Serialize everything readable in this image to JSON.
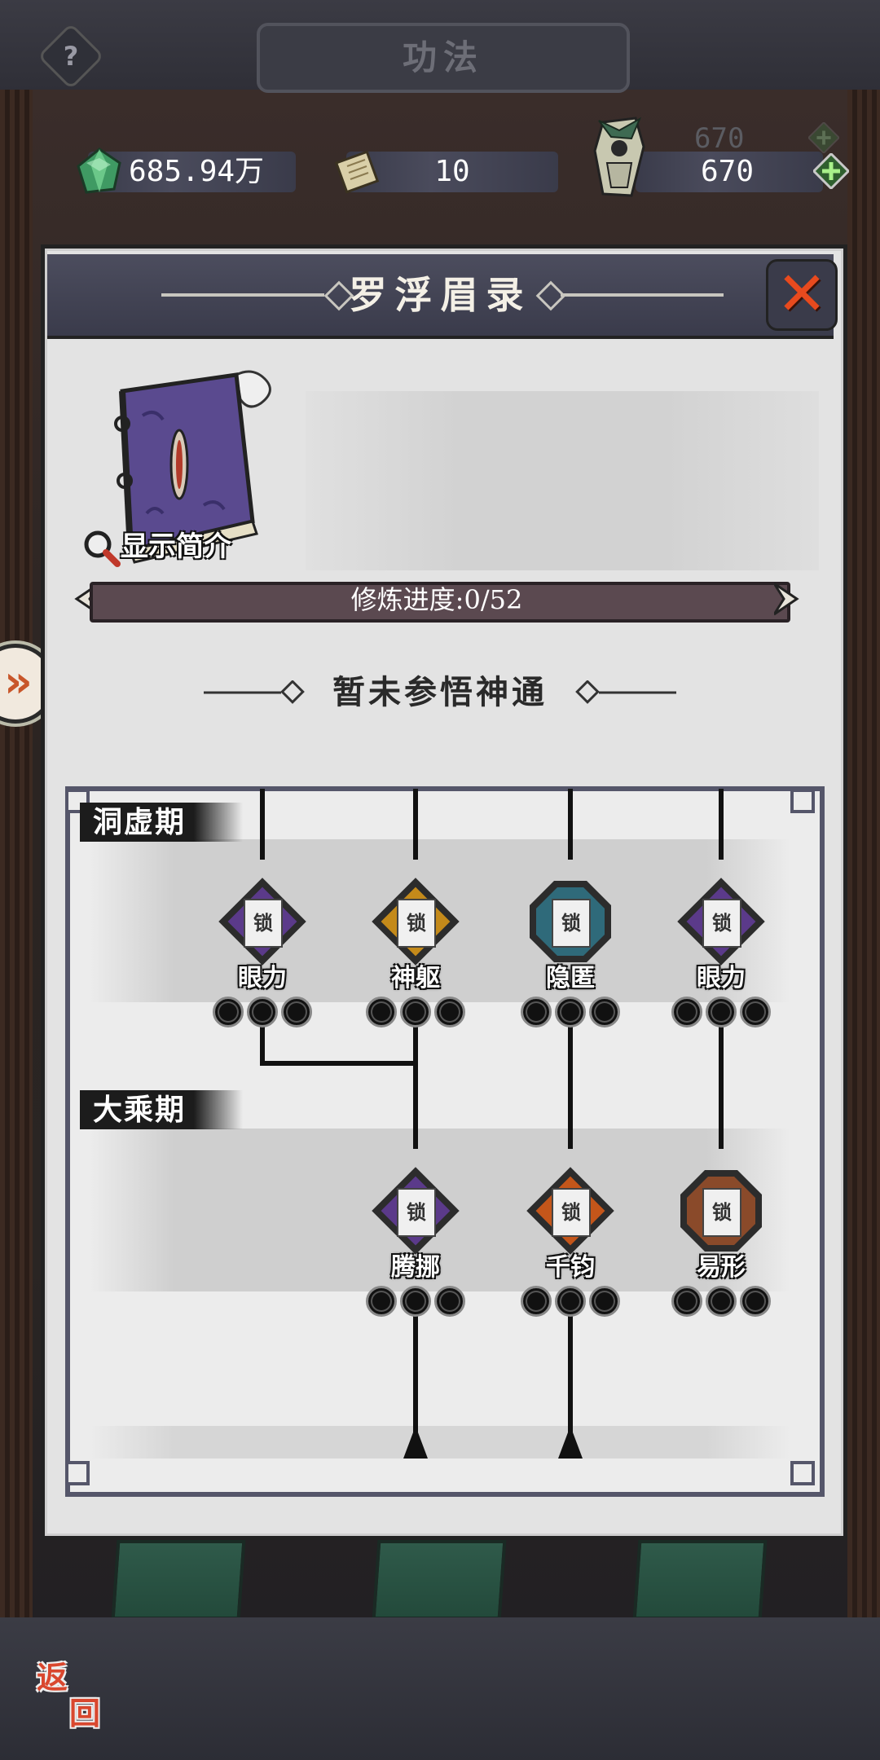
{
  "header": {
    "title": "功法",
    "help_glyph": "?"
  },
  "resources": {
    "spirit_stone": {
      "icon": "green-gem-icon",
      "value": "685.94万"
    },
    "scroll": {
      "icon": "scroll-icon",
      "value": "10"
    },
    "stamina": {
      "icon": "figure-icon",
      "value": "670",
      "ghost_value": "670",
      "add_icon": "plus-icon"
    }
  },
  "side_arrow": "»",
  "panel": {
    "title": "罗浮眉录",
    "close_icon": "close-x-icon",
    "show_intro_label": "显示简介",
    "progress_text": "修炼进度:0/52",
    "progress": {
      "current": 0,
      "total": 52
    },
    "subtitle": "暂未参悟神通"
  },
  "tree": {
    "stages": [
      {
        "label": "洞虚期"
      },
      {
        "label": "大乘期"
      }
    ],
    "nodes": [
      {
        "name": "眼力",
        "lock": "锁",
        "color": "#5b3a8a",
        "filled_dots": 0,
        "total_dots": 3
      },
      {
        "name": "神躯",
        "lock": "锁",
        "color": "#c48a1a",
        "filled_dots": 0,
        "total_dots": 3
      },
      {
        "name": "隐匿",
        "lock": "锁",
        "color": "#2f6a7a",
        "filled_dots": 0,
        "total_dots": 3
      },
      {
        "name": "眼力",
        "lock": "锁",
        "color": "#5b3a8a",
        "filled_dots": 0,
        "total_dots": 3
      },
      {
        "name": "腾挪",
        "lock": "锁",
        "color": "#5b3a8a",
        "filled_dots": 0,
        "total_dots": 3
      },
      {
        "name": "千钧",
        "lock": "锁",
        "color": "#c4561a",
        "filled_dots": 0,
        "total_dots": 3
      },
      {
        "name": "易形",
        "lock": "锁",
        "color": "#8a4a2a",
        "filled_dots": 0,
        "total_dots": 3
      }
    ]
  },
  "footer": {
    "return_label_1": "返",
    "return_label_2": "回"
  }
}
